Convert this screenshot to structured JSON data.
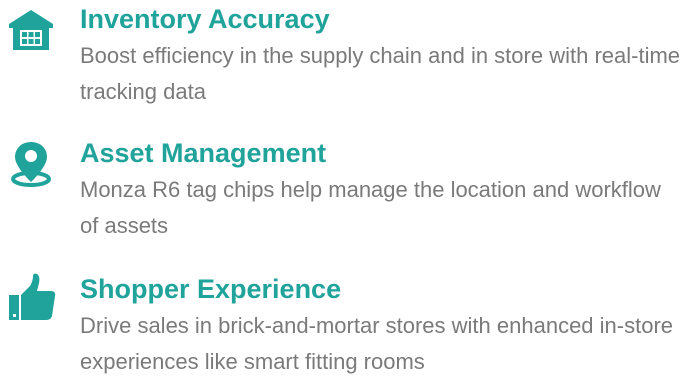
{
  "accent_color": "#1fa39a",
  "text_color": "#7a7a7a",
  "features": [
    {
      "icon": "warehouse-icon",
      "title": "Inventory Accuracy",
      "description": "Boost efficiency in the supply chain and in store with real-time tracking data"
    },
    {
      "icon": "location-pin-icon",
      "title": "Asset Management",
      "description": "Monza R6 tag chips help manage the location and workflow of assets"
    },
    {
      "icon": "thumbs-up-icon",
      "title": "Shopper Experience",
      "description": "Drive sales in brick-and-mortar stores with enhanced in-store experiences like smart fitting rooms"
    }
  ]
}
